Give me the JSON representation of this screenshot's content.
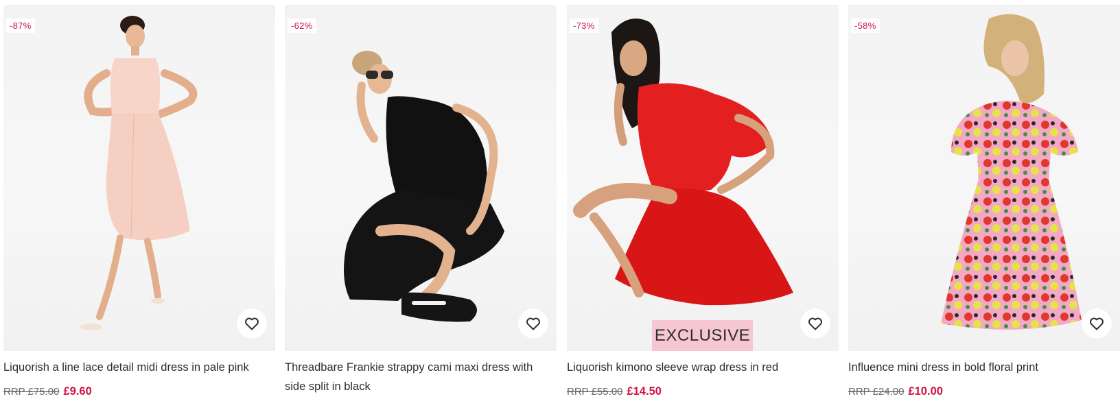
{
  "products": [
    {
      "discount": "-87%",
      "title": "Liquorish a line lace detail midi dress in pale pink",
      "rrp": "RRP £75.00",
      "price": "£9.60",
      "badge": "",
      "dress_color": "#f7d6c9",
      "save_icon": "heart-icon"
    },
    {
      "discount": "-62%",
      "title": "Threadbare Frankie strappy cami maxi dress with side split in black",
      "rrp": "",
      "price": "",
      "badge": "",
      "dress_color": "#111111",
      "save_icon": "heart-icon"
    },
    {
      "discount": "-73%",
      "title": "Liquorish kimono sleeve wrap dress in red",
      "rrp": "RRP £55.00",
      "price": "£14.50",
      "badge": "EXCLUSIVE",
      "dress_color": "#e41f1f",
      "save_icon": "heart-icon"
    },
    {
      "discount": "-58%",
      "title": "Influence mini dress in bold floral print",
      "rrp": "RRP £24.00",
      "price": "£10.00",
      "badge": "",
      "dress_color": "#e46b8a",
      "save_icon": "heart-icon"
    }
  ],
  "colors": {
    "sale": "#d01345",
    "text": "#2d2d2d",
    "badge_bg": "#f6c7d3"
  }
}
